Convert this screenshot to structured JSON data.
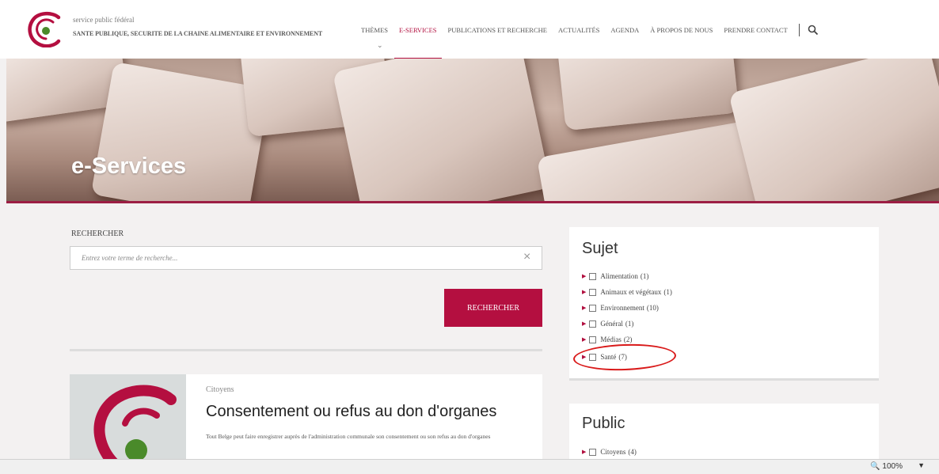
{
  "header": {
    "org_line1": "service public fédéral",
    "org_line2": "SANTE PUBLIQUE, SECURITE DE LA CHAINE ALIMENTAIRE ET ENVIRONNEMENT",
    "nav": [
      {
        "label": "THÈMES"
      },
      {
        "label": "E-SERVICES"
      },
      {
        "label": "PUBLICATIONS ET RECHERCHE"
      },
      {
        "label": "ACTUALITÉS"
      },
      {
        "label": "AGENDA"
      },
      {
        "label": "À PROPOS DE NOUS"
      },
      {
        "label": "PRENDRE CONTACT"
      }
    ],
    "active_nav": "E-SERVICES",
    "search_icon": "search-icon",
    "brand_color": "#b10e3e"
  },
  "hero": {
    "title": "e-Services"
  },
  "search": {
    "label": "RECHERCHER",
    "placeholder": "Entrez votre terme de recherche...",
    "value": "",
    "button_label": "RECHERCHER"
  },
  "results": [
    {
      "category": "Citoyens",
      "title": "Consentement ou refus au don d'organes",
      "description": "Tout Belge peut faire enregistrer auprès de l'administration communale son consentement ou son refus au don d'organes"
    }
  ],
  "filters": {
    "sujet": {
      "title": "Sujet",
      "items": [
        {
          "label": "Alimentation",
          "count": "(1)",
          "checked": false
        },
        {
          "label": "Animaux et végétaux",
          "count": "(1)",
          "checked": false
        },
        {
          "label": "Environnement",
          "count": "(10)",
          "checked": false
        },
        {
          "label": "Général",
          "count": "(1)",
          "checked": false
        },
        {
          "label": "Médias",
          "count": "(2)",
          "checked": false
        },
        {
          "label": "Santé",
          "count": "(7)",
          "checked": false
        }
      ]
    },
    "public": {
      "title": "Public",
      "items": [
        {
          "label": "Citoyens",
          "count": "(4)",
          "checked": false
        }
      ]
    }
  },
  "annotation": {
    "highlighted_item": "Santé",
    "color": "#d91a1a"
  },
  "statusbar": {
    "zoom": "100%"
  }
}
